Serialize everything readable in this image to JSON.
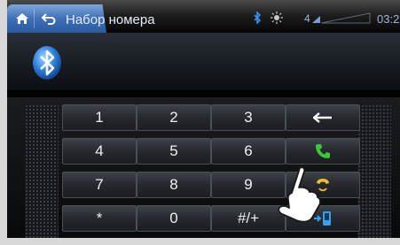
{
  "topbar": {
    "title": "Набор номера",
    "signal_text": "4",
    "clock": "03:2",
    "home_icon": "home-icon",
    "back_icon": "back-arrow-icon",
    "bluetooth_icon": "bluetooth-icon",
    "sun_icon": "sun-icon",
    "signal_icon": "signal-strength-icon"
  },
  "header": {
    "logo_icon": "bluetooth-logo-icon"
  },
  "keypad": {
    "rows": [
      [
        "1",
        "2",
        "3"
      ],
      [
        "4",
        "5",
        "6"
      ],
      [
        "7",
        "8",
        "9"
      ],
      [
        "*",
        "0",
        "#/+"
      ]
    ],
    "side_icons": [
      "backspace-icon",
      "call-icon",
      "end-call-icon",
      "transfer-to-phone-icon"
    ]
  },
  "colors": {
    "accent_blue": "#3f6fb8",
    "call_green": "#3cc43c",
    "end_call_yellow": "#e8c020",
    "transfer_blue": "#3aa0e8"
  }
}
